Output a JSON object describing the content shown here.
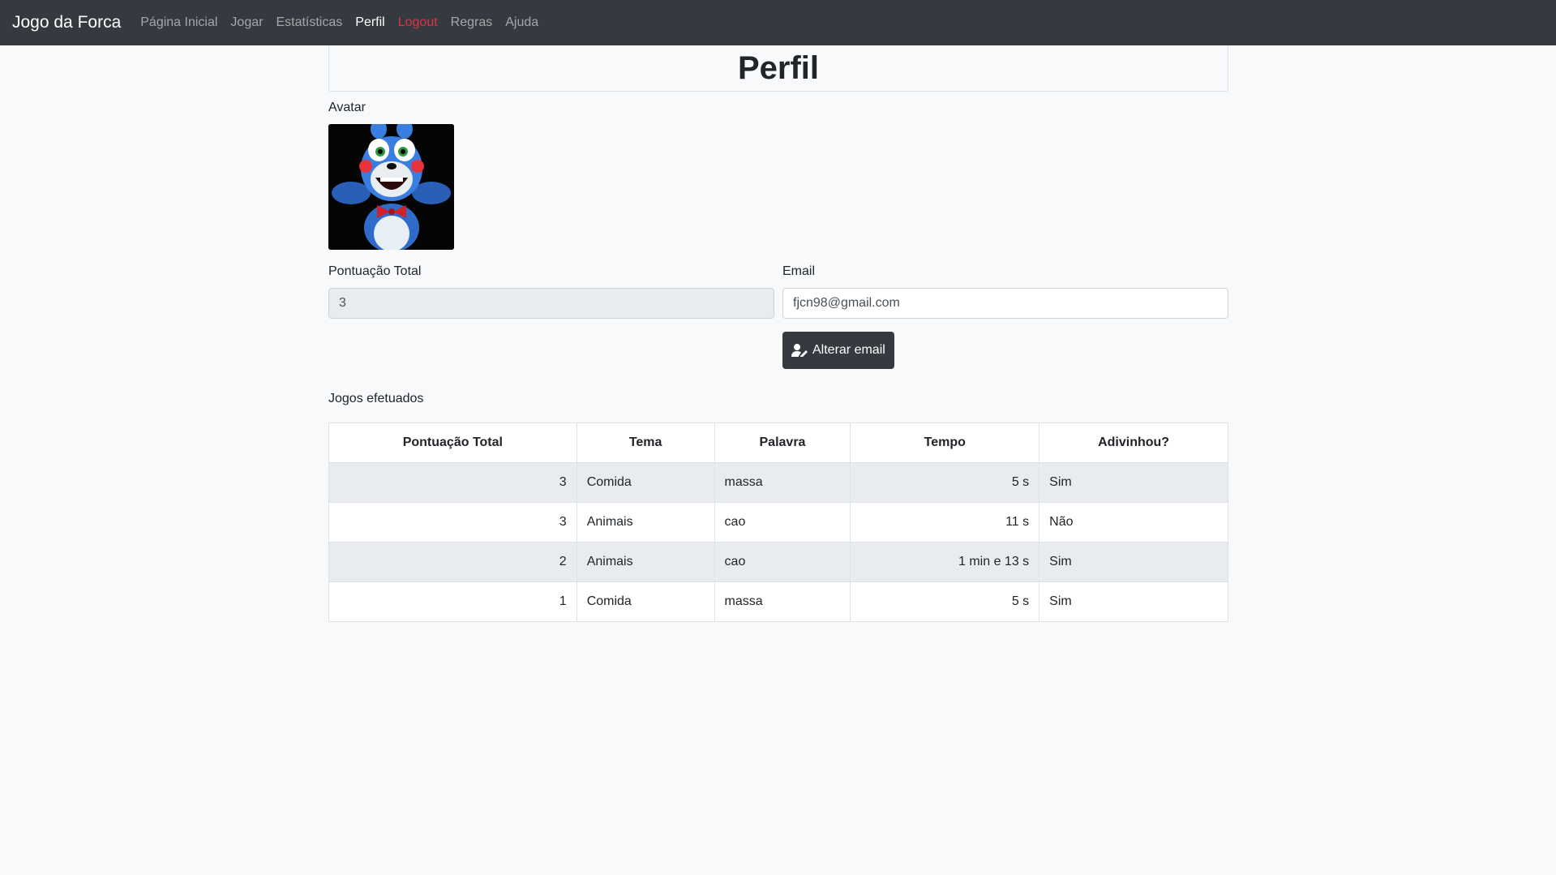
{
  "navbar": {
    "brand": "Jogo da Forca",
    "items": [
      {
        "label": "Página Inicial"
      },
      {
        "label": "Jogar"
      },
      {
        "label": "Estatísticas"
      },
      {
        "label": "Perfil"
      },
      {
        "label": "Logout"
      },
      {
        "label": "Regras"
      },
      {
        "label": "Ajuda"
      }
    ]
  },
  "page": {
    "title": "Perfil",
    "avatar_label": "Avatar",
    "score_label": "Pontuação Total",
    "score_value": "3",
    "email_label": "Email",
    "email_value": "fjcn98@gmail.com",
    "change_email_button": "Alterar email",
    "games_label": "Jogos efetuados"
  },
  "table": {
    "headers": [
      "Pontuação Total",
      "Tema",
      "Palavra",
      "Tempo",
      "Adivinhou?"
    ],
    "rows": [
      [
        "3",
        "Comida",
        "massa",
        "5 s",
        "Sim"
      ],
      [
        "3",
        "Animais",
        "cao",
        "11 s",
        "Não"
      ],
      [
        "2",
        "Animais",
        "cao",
        "1 min e 13 s",
        "Sim"
      ],
      [
        "1",
        "Comida",
        "massa",
        "5 s",
        "Sim"
      ]
    ]
  },
  "colors": {
    "navbar": "#343a40",
    "logout": "#dc3545",
    "button": "#343a40"
  }
}
